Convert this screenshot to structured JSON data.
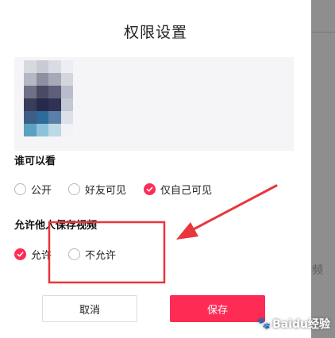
{
  "dialog": {
    "title": "权限设置"
  },
  "preview": {
    "thumbnail": "pixelated-video-thumbnail"
  },
  "visibility": {
    "label": "谁可以看",
    "options": [
      {
        "label": "公开",
        "checked": false
      },
      {
        "label": "好友可见",
        "checked": false
      },
      {
        "label": "仅自己可见",
        "checked": true
      }
    ]
  },
  "save_permission": {
    "label": "允许他人保存视频",
    "options": [
      {
        "label": "允许",
        "checked": true
      },
      {
        "label": "不允许",
        "checked": false
      }
    ]
  },
  "buttons": {
    "cancel": "取消",
    "save": "保存"
  },
  "backdrop": {
    "char": "频"
  },
  "colors": {
    "accent": "#fe2c55",
    "annotation": "#e8363c"
  },
  "watermark": {
    "text": "Baidu经验",
    "icon": "paw-icon"
  }
}
